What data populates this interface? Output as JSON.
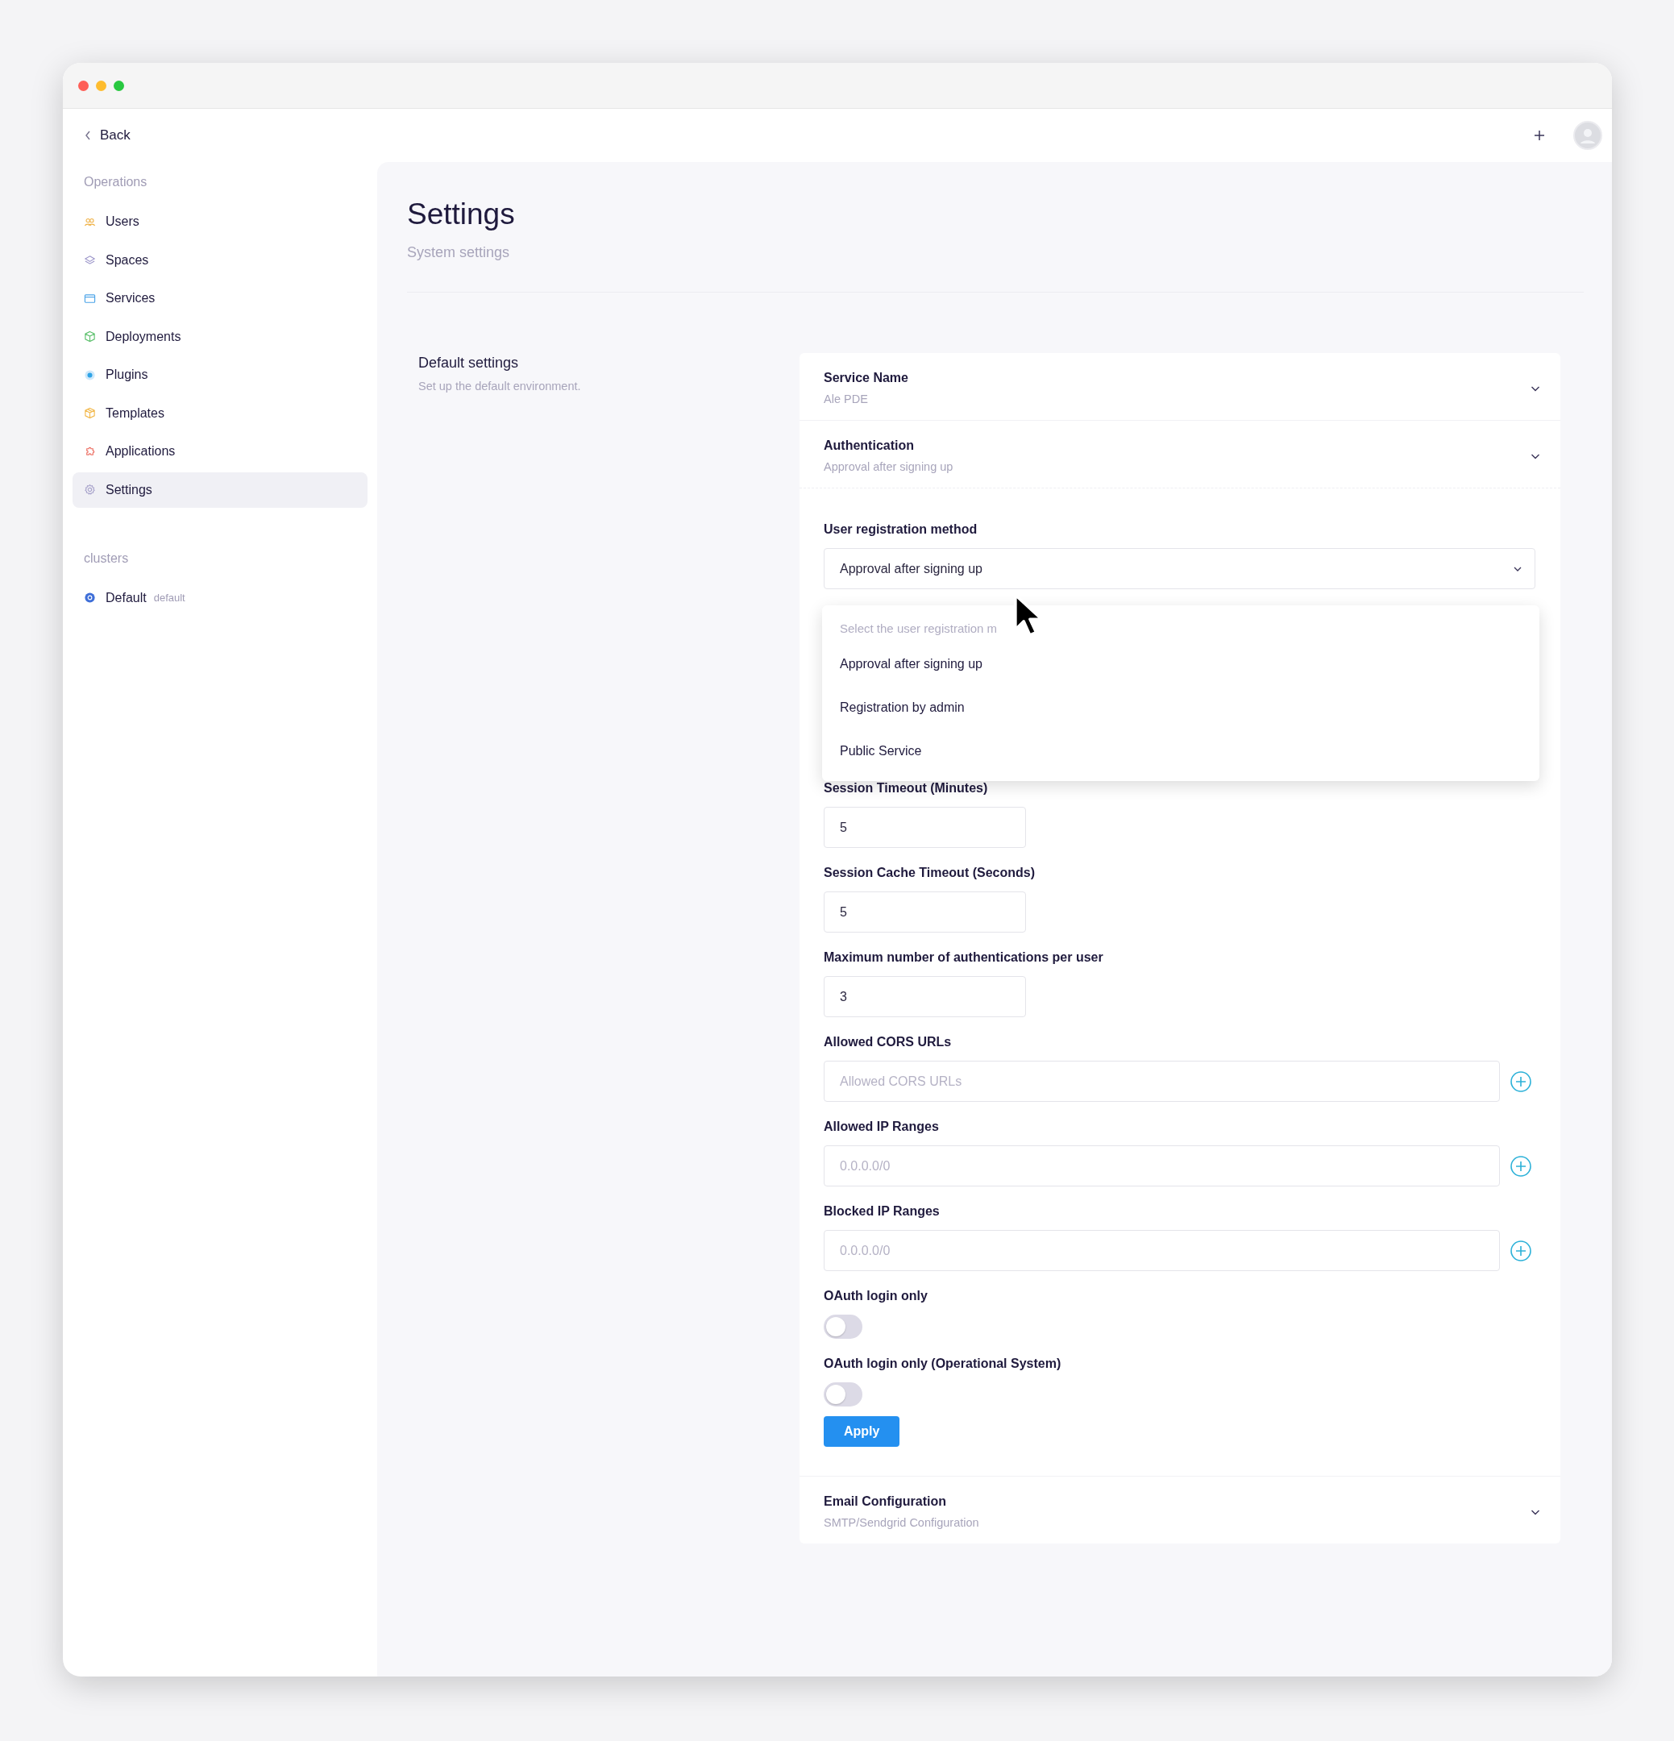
{
  "header": {
    "back_label": "Back"
  },
  "sidebar": {
    "sections": [
      {
        "title": "Operations",
        "items": [
          {
            "label": "Users",
            "kind": "users",
            "selected": false
          },
          {
            "label": "Spaces",
            "kind": "layers",
            "selected": false
          },
          {
            "label": "Services",
            "kind": "window",
            "selected": false
          },
          {
            "label": "Deployments",
            "kind": "cube",
            "selected": false
          },
          {
            "label": "Plugins",
            "kind": "plugin",
            "selected": false
          },
          {
            "label": "Templates",
            "kind": "box",
            "selected": false
          },
          {
            "label": "Applications",
            "kind": "puzzle",
            "selected": false
          },
          {
            "label": "Settings",
            "kind": "gear",
            "selected": true
          }
        ]
      },
      {
        "title": "clusters",
        "items": [
          {
            "label": "Default",
            "tag": "default",
            "kind": "cluster",
            "selected": false
          }
        ]
      }
    ]
  },
  "page": {
    "title": "Settings",
    "subtitle": "System settings"
  },
  "section": {
    "title": "Default settings",
    "description": "Set up the default environment."
  },
  "panels": [
    {
      "title": "Service Name",
      "summary": "Ale PDE",
      "expanded": false
    },
    {
      "title": "Authentication",
      "summary": "Approval after signing up",
      "expanded": true,
      "form": {
        "registration": {
          "label": "User registration method",
          "value": "Approval after signing up",
          "dropdown": {
            "hint": "Select the user registration m",
            "options": [
              {
                "label": "Approval after signing up",
                "selected": false
              },
              {
                "label": "Registration by admin",
                "selected": false
              },
              {
                "label": "Public Service",
                "selected": false
              }
            ]
          }
        },
        "fields": [
          {
            "kind": "number",
            "label": "Session Timeout (Minutes)",
            "value": "5"
          },
          {
            "kind": "number",
            "label": "Session Cache Timeout (Seconds)",
            "value": "5"
          },
          {
            "kind": "number",
            "label": "Maximum number of authentications per user",
            "value": "3"
          },
          {
            "kind": "list",
            "label": "Allowed CORS URLs",
            "placeholder": "Allowed CORS URLs"
          },
          {
            "kind": "list",
            "label": "Allowed IP Ranges",
            "placeholder": "0.0.0.0/0"
          },
          {
            "kind": "list",
            "label": "Blocked IP Ranges",
            "placeholder": "0.0.0.0/0"
          },
          {
            "kind": "toggle",
            "label": "OAuth login only",
            "on": false
          },
          {
            "kind": "toggle",
            "label": "OAuth login only (Operational System)",
            "on": false
          }
        ],
        "apply_label": "Apply"
      }
    },
    {
      "title": "Email Configuration",
      "summary": "SMTP/Sendgrid Configuration",
      "expanded": false
    }
  ]
}
